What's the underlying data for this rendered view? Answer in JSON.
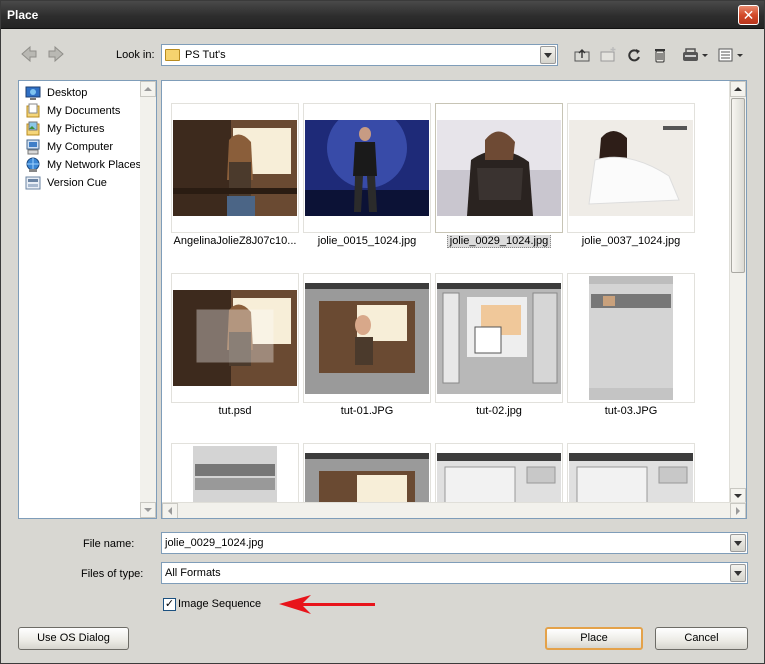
{
  "window": {
    "title": "Place",
    "close_glyph": "✕"
  },
  "toolbar": {
    "look_in_label": "Look in:",
    "look_in_value": "PS Tut's",
    "icons": [
      "back-arrow-icon",
      "forward-arrow-icon",
      "up-folder-icon",
      "new-folder-icon",
      "refresh-icon",
      "delete-icon",
      "tools-icon",
      "view-menu-icon"
    ]
  },
  "places": {
    "items": [
      {
        "label": "Desktop",
        "icon": "desktop-icon"
      },
      {
        "label": "My Documents",
        "icon": "documents-icon"
      },
      {
        "label": "My Pictures",
        "icon": "pictures-icon"
      },
      {
        "label": "My Computer",
        "icon": "computer-icon"
      },
      {
        "label": "My Network Places",
        "icon": "network-icon"
      },
      {
        "label": "Version Cue",
        "icon": "version-cue-icon"
      }
    ]
  },
  "files": {
    "items": [
      {
        "name": "AngelinaJolieZ8J07c10...",
        "selected": false
      },
      {
        "name": "jolie_0015_1024.jpg",
        "selected": false
      },
      {
        "name": "jolie_0029_1024.jpg",
        "selected": true
      },
      {
        "name": "jolie_0037_1024.jpg",
        "selected": false
      },
      {
        "name": "tut.psd",
        "selected": false
      },
      {
        "name": "tut-01.JPG",
        "selected": false
      },
      {
        "name": "tut-02.jpg",
        "selected": false
      },
      {
        "name": "tut-03.JPG",
        "selected": false
      }
    ],
    "partial_rows": 4
  },
  "form": {
    "file_name_label": "File name:",
    "file_name_value": "jolie_0029_1024.jpg",
    "file_type_label": "Files of type:",
    "file_type_value": "All Formats",
    "image_sequence_label": "Image Sequence",
    "image_sequence_checked": true,
    "check_glyph": "✓"
  },
  "buttons": {
    "os_dialog": "Use OS Dialog",
    "place": "Place",
    "cancel": "Cancel"
  },
  "colors": {
    "title_bar": "#2d2d2d",
    "close_button": "#d24a2a",
    "default_button_border": "#e4a24a",
    "annotation_arrow": "#e8141b"
  }
}
